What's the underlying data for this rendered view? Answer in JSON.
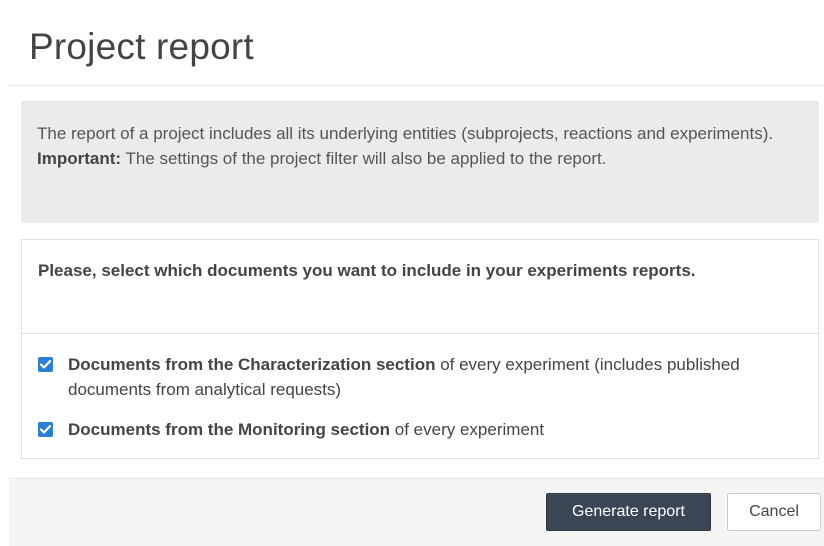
{
  "dialog": {
    "title": "Project report"
  },
  "info": {
    "line1": "The report of a project includes all its underlying entities (subprojects, reactions and experiments).",
    "important_label": "Important:",
    "important_text": " The settings of the project filter will also be applied to the report."
  },
  "documents": {
    "heading": "Please, select which documents you want to include in your experiments reports.",
    "options": [
      {
        "bold": "Documents from the Characterization section",
        "rest": " of every experiment (includes published documents from analytical requests)",
        "checked": true
      },
      {
        "bold": "Documents from the Monitoring section",
        "rest": " of every experiment",
        "checked": true
      }
    ]
  },
  "footer": {
    "generate_label": "Generate report",
    "cancel_label": "Cancel"
  },
  "colors": {
    "checkbox": "#2a7fd4",
    "primary_button": "#3a4654",
    "info_background": "#ebebeb"
  }
}
